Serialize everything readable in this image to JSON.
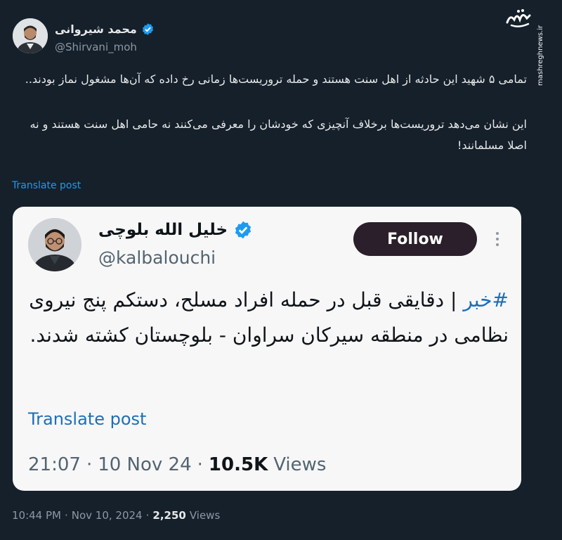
{
  "author": {
    "name": "محمد شیروانی",
    "handle": "@Shirvani_moh"
  },
  "watermark": {
    "logo_text": "مشرق",
    "site": "mashreghnews.ir"
  },
  "post": {
    "paragraphs": [
      "تمامی ۵ شهید این حادثه از اهل سنت هستند و حمله تروریست‌ها زمانی رخ داده که آن‌ها مشغول نماز بودند..",
      "این نشان می‌دهد تروریست‌ها برخلاف آنچیزی که خودشان را معرفی می‌کنند نه حامی اهل سنت هستند و نه اصلا مسلمانند!"
    ],
    "translate_label": "Translate post",
    "time": "10:44 PM",
    "date": "Nov 10, 2024",
    "views_count": "2,250",
    "views_label": "Views"
  },
  "quoted": {
    "name": "خلیل الله بلوچی",
    "handle": "@kalbalouchi",
    "follow_label": "Follow",
    "hashtag": "#خبر",
    "text": " | دقایقی قبل در حمله افراد مسلح، دستکم پنج نیروی نظامی در منطقه سیرکان سراوان - بلوچستان کشته شدند.",
    "translate_label": "Translate post",
    "time": "21:07",
    "date": "10 Nov 24",
    "views_count": "10.5K",
    "views_label": "Views"
  },
  "colors": {
    "background": "#15202b",
    "link": "#1d9bf0",
    "verified": "#1d9bf0",
    "card": "#f7f7f8",
    "follow_button": "#2a1f2b"
  },
  "icons": {
    "verified": "verified-badge-icon",
    "more": "more-dots-icon"
  }
}
